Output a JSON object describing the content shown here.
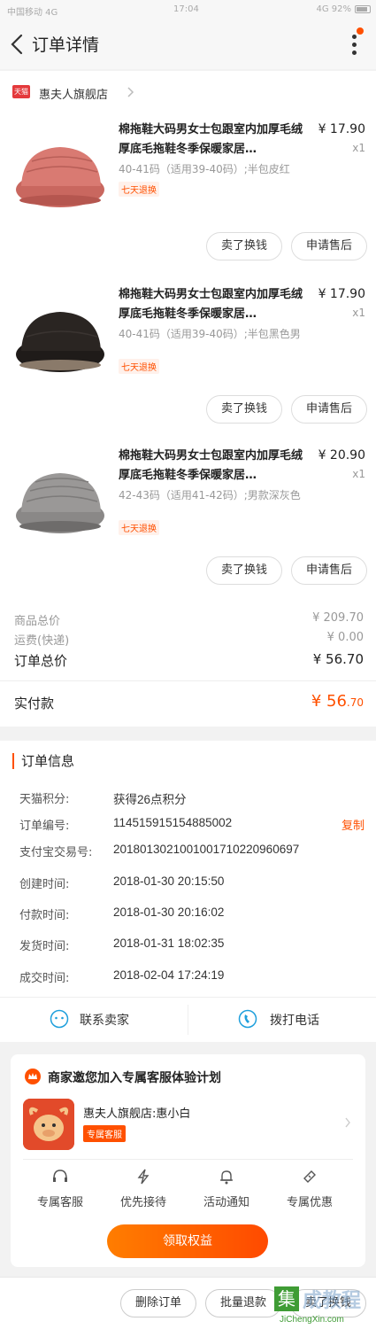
{
  "status_bar": {
    "left": "中国移动 4G",
    "time": "17:04",
    "right": "4G 92%"
  },
  "nav": {
    "title": "订单详情"
  },
  "shop": {
    "badge": "天猫",
    "name": "惠夫人旗舰店"
  },
  "items": [
    {
      "title": "棉拖鞋大码男女士包跟室内加厚毛绒厚底毛拖鞋冬季保暖家居…",
      "sku": "40-41码（适用39-40码）;半包皮红",
      "tag": "七天退换",
      "price": "¥ 17.90",
      "qty": "x1",
      "btn_sell": "卖了换钱",
      "btn_after": "申请售后",
      "color": "#d97a72"
    },
    {
      "title": "棉拖鞋大码男女士包跟室内加厚毛绒厚底毛拖鞋冬季保暖家居…",
      "sku": "40-41码（适用39-40码）;半包黑色男",
      "tag": "七天退换",
      "price": "¥ 17.90",
      "qty": "x1",
      "btn_sell": "卖了换钱",
      "btn_after": "申请售后",
      "color": "#2a2522"
    },
    {
      "title": "棉拖鞋大码男女士包跟室内加厚毛绒厚底毛拖鞋冬季保暖家居…",
      "sku": "42-43码（适用41-42码）;男款深灰色",
      "tag": "七天退换",
      "price": "¥ 20.90",
      "qty": "x1",
      "btn_sell": "卖了换钱",
      "btn_after": "申请售后",
      "color": "#9a9897"
    }
  ],
  "summary": {
    "goods_label": "商品总价",
    "goods_value": "¥ 209.70",
    "shipping_label": "运费(快递)",
    "shipping_value": "¥ 0.00",
    "total_label": "订单总价",
    "total_value": "¥ 56.70",
    "paid_label": "实付款",
    "paid_big": "¥ 56",
    "paid_small": ".70"
  },
  "order_info": {
    "heading": "订单信息",
    "rows": [
      {
        "k": "天猫积分:",
        "v": "获得26点积分"
      },
      {
        "k": "订单编号:",
        "v": "114515915154885002"
      },
      {
        "k": "支付宝交易号:",
        "v": "2018013021001001710220960697"
      },
      {
        "k": "创建时间:",
        "v": "2018-01-30 20:15:50"
      },
      {
        "k": "付款时间:",
        "v": "2018-01-30 20:16:02"
      },
      {
        "k": "发货时间:",
        "v": "2018-01-31 18:02:35"
      },
      {
        "k": "成交时间:",
        "v": "2018-02-04 17:24:19"
      }
    ],
    "copy_label": "复制",
    "contact_seller": "联系卖家",
    "call_phone": "拨打电话"
  },
  "vip": {
    "title": "商家邀您加入专属客服体验计划",
    "name": "惠夫人旗舰店:惠小白",
    "tag": "专属客服",
    "benefits": [
      "专属客服",
      "优先接待",
      "活动通知",
      "专属优惠"
    ],
    "claim": "领取权益"
  },
  "bottom": {
    "delete": "删除订单",
    "refund": "批量退款",
    "sell": "卖了换钱"
  },
  "watermark": {
    "box": "集",
    "main": "成教程",
    "sub": "JiChengXin.com"
  },
  "colors": {
    "accent": "#ff5000",
    "tmall": "#e4393c"
  }
}
